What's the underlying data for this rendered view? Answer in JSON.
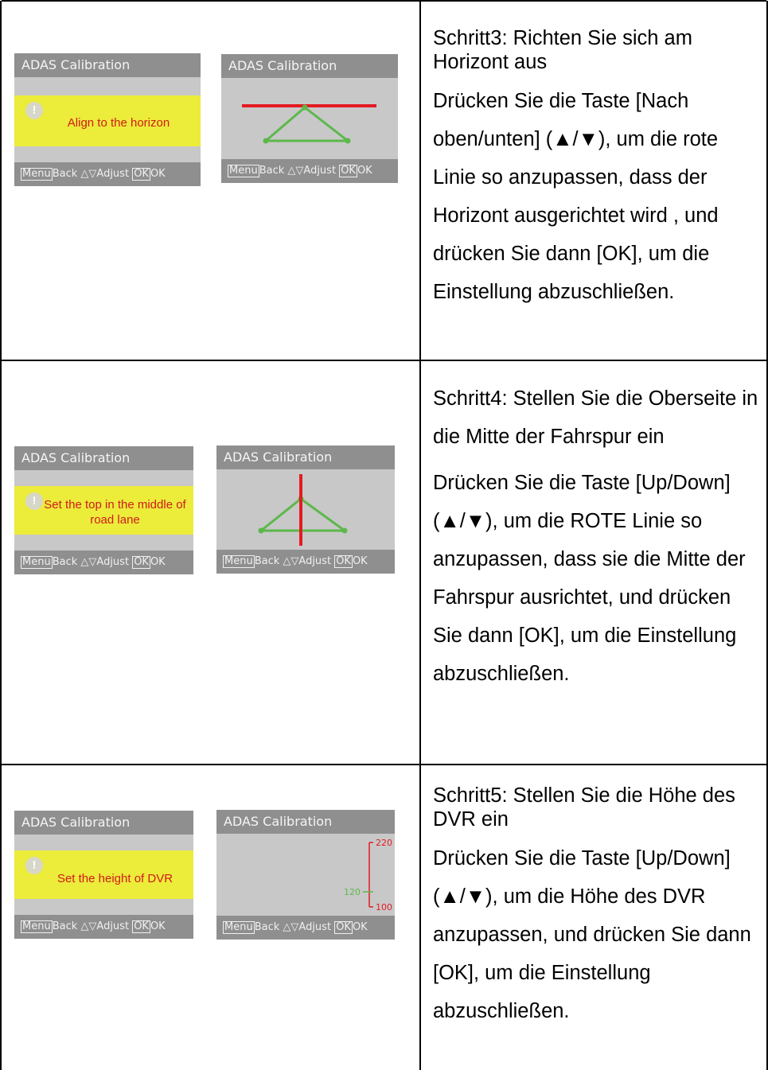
{
  "steps": [
    {
      "title": "Schritt3: Richten Sie sich am Horizont aus",
      "body": "Drücken Sie die Taste [Nach oben/unten] (▲/▼), um die rote Linie so anzupassen, dass der Horizont ausgerichtet wird , und drücken Sie dann [OK], um die Einstellung abzuschließen.",
      "prompt_screen": {
        "header": "ADAS Calibration",
        "message": "Align to the horizon"
      },
      "adjust_screen": {
        "header": "ADAS Calibration"
      }
    },
    {
      "title": "Schritt4: Stellen Sie die Oberseite in die Mitte der Fahrspur ein",
      "body": "Drücken Sie die Taste [Up/Down] (▲/▼), um die ROTE Linie so anzupassen, dass sie die Mitte der Fahrspur ausrichtet, und drücken Sie dann [OK], um die Einstellung abzuschließen.",
      "prompt_screen": {
        "header": "ADAS Calibration",
        "message": "Set the top in the middle of road lane"
      },
      "adjust_screen": {
        "header": "ADAS Calibration"
      }
    },
    {
      "title": "Schritt5: Stellen Sie die Höhe des DVR ein",
      "body": "Drücken Sie die Taste [Up/Down] (▲/▼), um die Höhe des DVR anzupassen, und drücken Sie dann [OK], um die Einstellung abzuschließen.",
      "prompt_screen": {
        "header": "ADAS Calibration",
        "message": "Set the height of DVR"
      },
      "adjust_screen": {
        "header": "ADAS Calibration",
        "scale_max": "220",
        "scale_value": "120",
        "scale_min": "100"
      }
    }
  ],
  "footer": {
    "menu_key": "Menu",
    "back": "Back",
    "adjust_icon": "△▽",
    "adjust": "Adjust",
    "ok_key": "OK",
    "ok": "OK"
  },
  "colors": {
    "message_bg": "#ecec3a",
    "red_line": "#e31b23",
    "green_line": "#5cb84a",
    "header_bg": "#8f8f8f",
    "screen_bg": "#c8c8c8"
  }
}
